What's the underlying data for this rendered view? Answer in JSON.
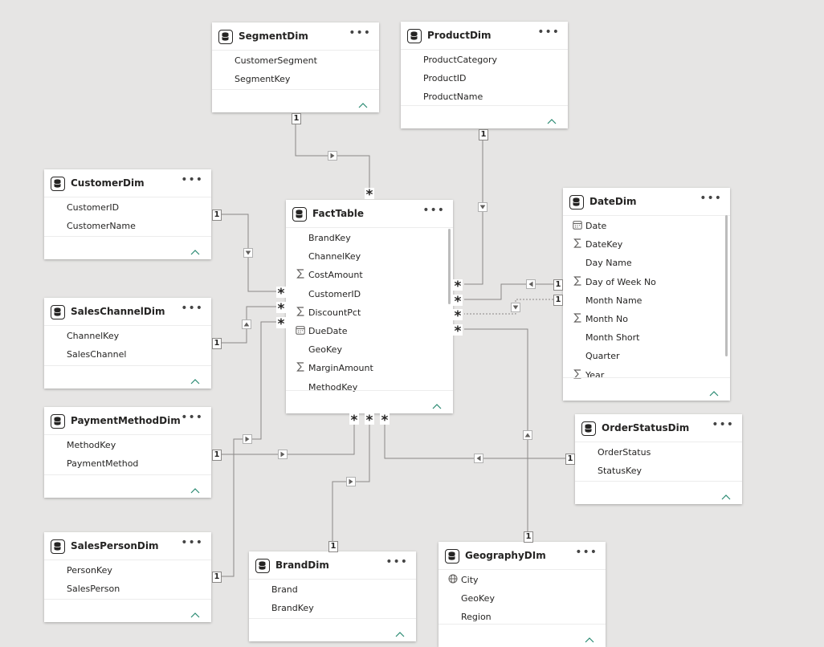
{
  "tables": [
    {
      "id": "segment",
      "title": "SegmentDim",
      "fields": [
        {
          "name": "CustomerSegment",
          "icon": ""
        },
        {
          "name": "SegmentKey",
          "icon": ""
        }
      ]
    },
    {
      "id": "product",
      "title": "ProductDim",
      "fields": [
        {
          "name": "ProductCategory",
          "icon": ""
        },
        {
          "name": "ProductID",
          "icon": ""
        },
        {
          "name": "ProductName",
          "icon": ""
        }
      ]
    },
    {
      "id": "customer",
      "title": "CustomerDim",
      "fields": [
        {
          "name": "CustomerID",
          "icon": ""
        },
        {
          "name": "CustomerName",
          "icon": ""
        }
      ]
    },
    {
      "id": "fact",
      "title": "FactTable",
      "fields": [
        {
          "name": "BrandKey",
          "icon": ""
        },
        {
          "name": "ChannelKey",
          "icon": ""
        },
        {
          "name": "CostAmount",
          "icon": "sigma"
        },
        {
          "name": "CustomerID",
          "icon": ""
        },
        {
          "name": "DiscountPct",
          "icon": "sigma"
        },
        {
          "name": "DueDate",
          "icon": "calendar"
        },
        {
          "name": "GeoKey",
          "icon": ""
        },
        {
          "name": "MarginAmount",
          "icon": "sigma"
        },
        {
          "name": "MethodKey",
          "icon": ""
        }
      ]
    },
    {
      "id": "date",
      "title": "DateDim",
      "fields": [
        {
          "name": "Date",
          "icon": "calendar"
        },
        {
          "name": "DateKey",
          "icon": "sigma"
        },
        {
          "name": "Day Name",
          "icon": ""
        },
        {
          "name": "Day of Week No",
          "icon": "sigma"
        },
        {
          "name": "Month Name",
          "icon": ""
        },
        {
          "name": "Month No",
          "icon": "sigma"
        },
        {
          "name": "Month Short",
          "icon": ""
        },
        {
          "name": "Quarter",
          "icon": ""
        },
        {
          "name": "Year",
          "icon": "sigma"
        }
      ]
    },
    {
      "id": "channel",
      "title": "SalesChannelDim",
      "fields": [
        {
          "name": "ChannelKey",
          "icon": ""
        },
        {
          "name": "SalesChannel",
          "icon": ""
        }
      ]
    },
    {
      "id": "payment",
      "title": "PaymentMethodDim",
      "fields": [
        {
          "name": "MethodKey",
          "icon": ""
        },
        {
          "name": "PaymentMethod",
          "icon": ""
        }
      ]
    },
    {
      "id": "orderstatus",
      "title": "OrderStatusDim",
      "fields": [
        {
          "name": "OrderStatus",
          "icon": ""
        },
        {
          "name": "StatusKey",
          "icon": ""
        }
      ]
    },
    {
      "id": "salesperson",
      "title": "SalesPersonDim",
      "fields": [
        {
          "name": "PersonKey",
          "icon": ""
        },
        {
          "name": "SalesPerson",
          "icon": ""
        }
      ]
    },
    {
      "id": "brand",
      "title": "BrandDim",
      "fields": [
        {
          "name": "Brand",
          "icon": ""
        },
        {
          "name": "BrandKey",
          "icon": ""
        }
      ]
    },
    {
      "id": "geography",
      "title": "GeographyDIm",
      "fields": [
        {
          "name": "City",
          "icon": "globe"
        },
        {
          "name": "GeoKey",
          "icon": ""
        },
        {
          "name": "Region",
          "icon": ""
        }
      ]
    }
  ],
  "relationships": [
    {
      "name": "segment-fact",
      "from": "SegmentDim",
      "to": "FactTable",
      "one": "1",
      "many": "*"
    },
    {
      "name": "product-fact",
      "from": "ProductDim",
      "to": "FactTable",
      "one": "1",
      "many": "*"
    },
    {
      "name": "customer-fact",
      "from": "CustomerDim",
      "to": "FactTable",
      "one": "1",
      "many": "*"
    },
    {
      "name": "channel-fact",
      "from": "SalesChannelDim",
      "to": "FactTable",
      "one": "1",
      "many": "*"
    },
    {
      "name": "payment-fact",
      "from": "PaymentMethodDim",
      "to": "FactTable",
      "one": "1",
      "many": "*"
    },
    {
      "name": "salesperson-fact",
      "from": "SalesPersonDim",
      "to": "FactTable",
      "one": "1",
      "many": "*"
    },
    {
      "name": "date-fact",
      "from": "DateDim",
      "to": "FactTable",
      "one": "1",
      "many": "*"
    },
    {
      "name": "date-fact-inactive",
      "from": "DateDim",
      "to": "FactTable",
      "one": "1",
      "many": "*",
      "inactive": true
    },
    {
      "name": "geography-fact",
      "from": "GeographyDIm",
      "to": "FactTable",
      "one": "1",
      "many": "*"
    },
    {
      "name": "orderstatus-fact",
      "from": "OrderStatusDim",
      "to": "FactTable",
      "one": "1",
      "many": "*"
    },
    {
      "name": "brand-fact",
      "from": "BrandDim",
      "to": "FactTable",
      "one": "1",
      "many": "*"
    }
  ],
  "colors": {
    "background": "#e6e5e4",
    "card": "#ffffff",
    "text": "#252423",
    "line": "#8a8886",
    "collapse": "#2a8a72"
  }
}
